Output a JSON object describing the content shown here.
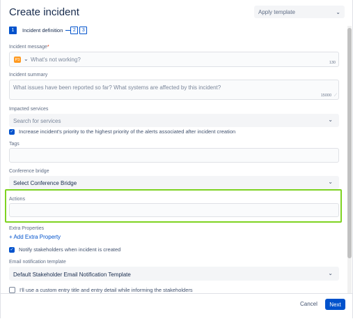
{
  "dialog": {
    "title": "Create incident",
    "template": {
      "value": "Apply template",
      "icon": "chevron-down-icon"
    }
  },
  "steps": {
    "active_number": "1",
    "active_label": "Incident definition",
    "next": [
      "2",
      "3"
    ]
  },
  "form": {
    "message": {
      "label": "Incident message",
      "required": "*",
      "priority": "P3",
      "placeholder": "What's not working?",
      "counter": "130"
    },
    "summary": {
      "label": "Incident summary",
      "placeholder": "What issues have been reported so far? What systems are affected by this incident?",
      "counter": "15000"
    },
    "services": {
      "label": "Impacted services",
      "placeholder": "Search for services"
    },
    "increase_priority": {
      "label": "Increase incident's priority to the highest priority of the alerts associated after incident creation",
      "checked": true
    },
    "tags": {
      "label": "Tags",
      "value": ""
    },
    "conference": {
      "label": "Conference bridge",
      "value": "Select Conference Bridge"
    },
    "actions": {
      "label": "Actions",
      "value": ""
    },
    "extra": {
      "label": "Extra Properties",
      "link": "+ Add Extra Property"
    },
    "notify": {
      "label": "Notify stakeholders when incident is created",
      "checked": true
    },
    "email_template": {
      "label": "Email notification template",
      "value": "Default Stakeholder Email Notification Template"
    },
    "custom_entry": {
      "label": "I'll use a custom entry title and entry detail while informing the stakeholders",
      "checked": false
    }
  },
  "footer": {
    "cancel": "Cancel",
    "next": "Next"
  },
  "colors": {
    "primary": "#0052cc",
    "highlight": "#7ed321",
    "priority": "#ff991f"
  }
}
